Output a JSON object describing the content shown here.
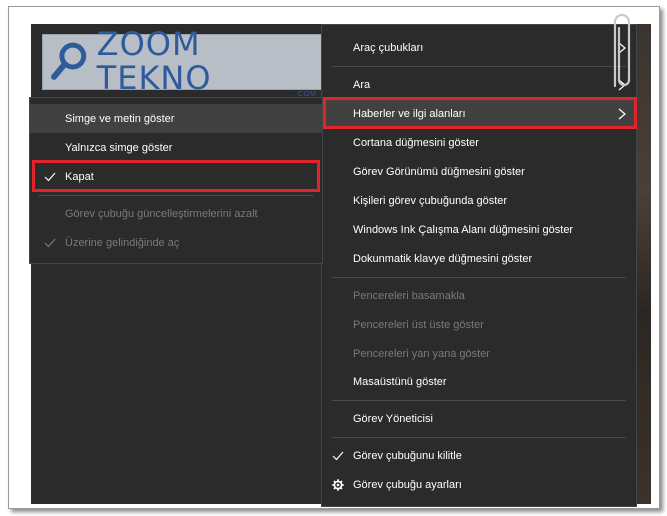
{
  "logo": {
    "title": "ZOOM TEKNO",
    "subtitle": ".COM",
    "icon": "magnifier-icon",
    "color": "#2f5a9c"
  },
  "left_menu": {
    "items": [
      {
        "label": "Simge ve metin göster",
        "checked": false,
        "disabled": false,
        "hovered": true
      },
      {
        "label": "Yalnızca simge göster",
        "checked": false,
        "disabled": false,
        "hovered": false
      },
      {
        "label": "Kapat",
        "checked": true,
        "disabled": false,
        "hovered": false,
        "highlighted": true
      },
      {
        "label": "Görev çubuğu güncelleştirmelerini azalt",
        "checked": false,
        "disabled": true,
        "hovered": false
      },
      {
        "label": "Üzerine gelindiğinde aç",
        "checked": true,
        "disabled": true,
        "hovered": false
      }
    ]
  },
  "right_menu": {
    "items": [
      {
        "label": "Araç çubukları",
        "submenu": true
      },
      {
        "label": "Ara",
        "submenu": true
      },
      {
        "label": "Haberler ve ilgi alanları",
        "submenu": true,
        "hovered": true,
        "highlighted": true
      },
      {
        "label": "Cortana düğmesini göster"
      },
      {
        "label": "Görev Görünümü düğmesini göster"
      },
      {
        "label": "Kişileri görev çubuğunda göster"
      },
      {
        "label": "Windows Ink Çalışma Alanı düğmesini göster"
      },
      {
        "label": "Dokunmatik klavye düğmesini göster"
      },
      {
        "label": "Pencereleri basamakla",
        "disabled": true
      },
      {
        "label": "Pencereleri üst üste göster",
        "disabled": true
      },
      {
        "label": "Pencereleri yan yana göster",
        "disabled": true
      },
      {
        "label": "Masaüstünü göster"
      },
      {
        "label": "Görev Yöneticisi"
      },
      {
        "label": "Görev çubuğunu kilitle",
        "checked": true
      },
      {
        "label": "Görev çubuğu ayarları",
        "icon": "gear-icon"
      }
    ]
  },
  "colors": {
    "menu_bg": "#2b2b2b",
    "highlight_border": "#e0242c",
    "disabled_text": "#7a7a7a",
    "hover_bg": "#414141"
  }
}
